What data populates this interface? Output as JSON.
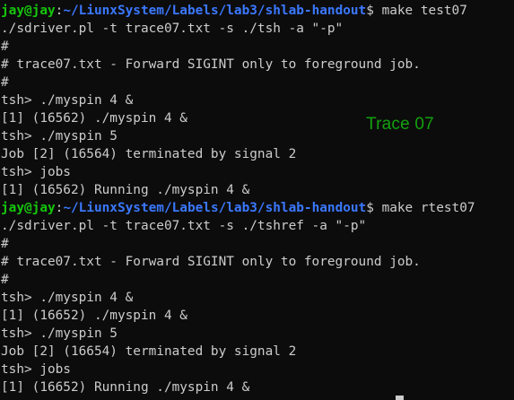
{
  "terminal": {
    "lines": [
      {
        "type": "prompt",
        "user": "jay@jay",
        "path": "~/LiunxSystem/Labels/lab3/shlab-handout",
        "command": " make test07"
      },
      {
        "type": "text",
        "text": "./sdriver.pl -t trace07.txt -s ./tsh -a \"-p\""
      },
      {
        "type": "text",
        "text": "#"
      },
      {
        "type": "text",
        "text": "# trace07.txt - Forward SIGINT only to foreground job."
      },
      {
        "type": "text",
        "text": "#"
      },
      {
        "type": "text",
        "text": "tsh> ./myspin 4 &"
      },
      {
        "type": "text",
        "text": "[1] (16562) ./myspin 4 &"
      },
      {
        "type": "text",
        "text": "tsh> ./myspin 5"
      },
      {
        "type": "text",
        "text": "Job [2] (16564) terminated by signal 2"
      },
      {
        "type": "text",
        "text": "tsh> jobs"
      },
      {
        "type": "text",
        "text": "[1] (16562) Running ./myspin 4 &"
      },
      {
        "type": "prompt",
        "user": "jay@jay",
        "path": "~/LiunxSystem/Labels/lab3/shlab-handout",
        "command": " make rtest07"
      },
      {
        "type": "text",
        "text": "./sdriver.pl -t trace07.txt -s ./tshref -a \"-p\""
      },
      {
        "type": "text",
        "text": "#"
      },
      {
        "type": "text",
        "text": "# trace07.txt - Forward SIGINT only to foreground job."
      },
      {
        "type": "text",
        "text": "#"
      },
      {
        "type": "text",
        "text": "tsh> ./myspin 4 &"
      },
      {
        "type": "text",
        "text": "[1] (16652) ./myspin 4 &"
      },
      {
        "type": "text",
        "text": "tsh> ./myspin 5"
      },
      {
        "type": "text",
        "text": "Job [2] (16654) terminated by signal 2"
      },
      {
        "type": "text",
        "text": "tsh> jobs"
      },
      {
        "type": "text",
        "text": "[1] (16652) Running ./myspin 4 &"
      }
    ]
  },
  "overlay_label": "Trace 07",
  "colors": {
    "background": "#0c0c0c",
    "foreground": "#cccccc",
    "prompt_user": "#16c60c",
    "prompt_path": "#3b78ff",
    "label": "#13a10e"
  }
}
